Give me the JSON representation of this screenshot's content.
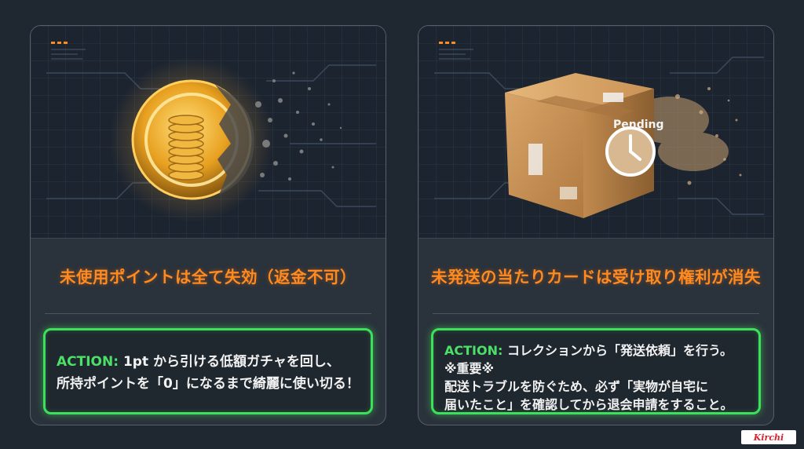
{
  "left_card": {
    "caption": "未使用ポイントは全て失効（返金不可）",
    "action_label": "ACTION:",
    "action_line1": "1pt から引ける低額ガチャを回し、",
    "action_line2": "所持ポイントを「0」になるまで綺麗に使い切る！",
    "illustration_icon": "disintegrating-coin-icon"
  },
  "right_card": {
    "caption": "未発送の当たりカードは受け取り権利が消失",
    "action_label": "ACTION:",
    "action_line1": "コレクションから「発送依頼」を行う。",
    "note_heading": "※重要※",
    "note_line1": "配送トラブルを防ぐため、必ず「実物が自宅に",
    "note_line2": "届いたこと」を確認してから退会申請をすること。",
    "box_label": "Pending",
    "illustration_icon": "disintegrating-package-icon"
  },
  "logo": {
    "text": "Kirchi"
  },
  "colors": {
    "caption": "#ff8a1f",
    "action_border": "#3de05a",
    "action_label": "#4ce068",
    "background": "#1f2730"
  }
}
